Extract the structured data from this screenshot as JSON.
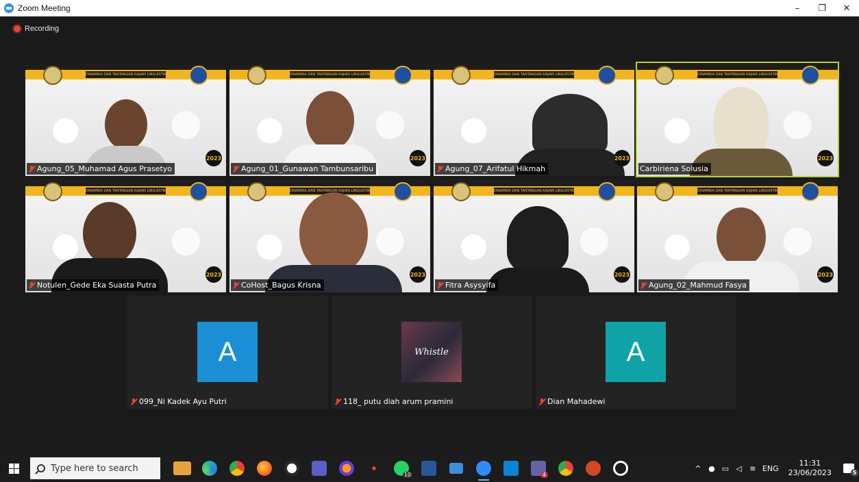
{
  "window": {
    "title": "Zoom Meeting",
    "minimize": "–",
    "restore": "❐",
    "close": "✕"
  },
  "recording": {
    "label": "Recording",
    "color": "#e8452d"
  },
  "banner_text": "DINAMIKA DAN TANTANGAN KAJIAN LINGUISTIK DAN SASTRA",
  "badge_year": "2023",
  "video_tiles": [
    {
      "name": "Agung_05_Muhamad Agus Prasetyo",
      "muted": true,
      "active": false
    },
    {
      "name": "Agung_01_Gunawan Tambunsaribu",
      "muted": true,
      "active": false
    },
    {
      "name": "Agung_07_Arifatul Hikmah",
      "muted": true,
      "active": false
    },
    {
      "name": "Carbiriena Solusia",
      "muted": false,
      "active": true
    },
    {
      "name": "Notulen_Gede Eka Suasta Putra",
      "muted": true,
      "active": false
    },
    {
      "name": "CoHost_Bagus Krisna",
      "muted": true,
      "active": false
    },
    {
      "name": "Fitra Asysyifa",
      "muted": true,
      "active": false
    },
    {
      "name": "Agung_02_Mahmud Fasya",
      "muted": true,
      "active": false
    }
  ],
  "avatar_tiles": [
    {
      "name": "099_Ni Kadek Ayu Putri",
      "initial": "A",
      "color": "#1b8fd6"
    },
    {
      "name": "118_ putu diah arum pramini",
      "image_text": "Whistle"
    },
    {
      "name": "Dian Mahadewi",
      "initial": "A",
      "color": "#0fa3a8"
    }
  ],
  "taskbar": {
    "search_placeholder": "Type here to search",
    "language": "ENG",
    "time": "11:31",
    "date": "23/06/2023",
    "whatsapp_badge": "10",
    "teams_badge": "4",
    "notifications_badge": "5"
  }
}
